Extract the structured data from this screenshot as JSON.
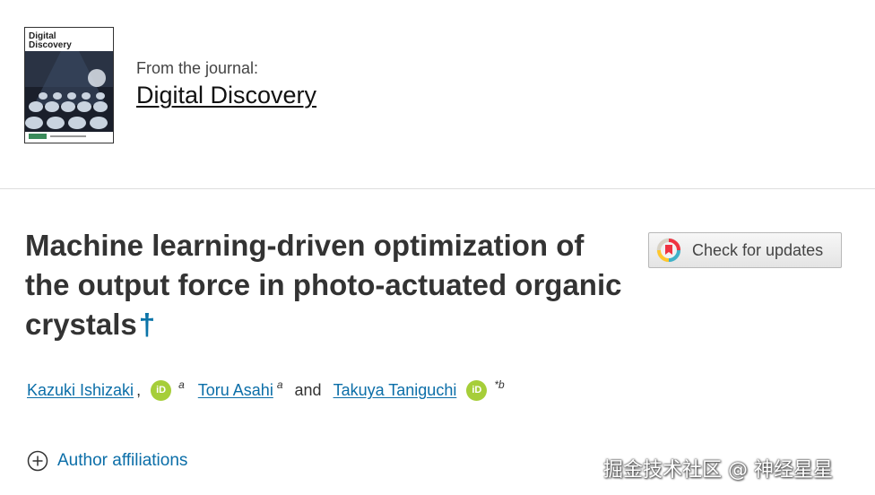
{
  "journal": {
    "cover_title": "Digital Discovery",
    "from_label": "From the journal:",
    "name": "Digital Discovery"
  },
  "article": {
    "title": "Machine learning-driven optimization of the output force in photo-actuated organic crystals",
    "dagger": "†"
  },
  "check_updates": {
    "label": "Check for updates"
  },
  "authors": [
    {
      "name": "Kazuki Ishizaki",
      "orcid": "iD",
      "affiliation": "a"
    },
    {
      "name": "Toru Asahi",
      "affiliation": "a"
    },
    {
      "name": "Takuya Taniguchi",
      "orcid": "iD",
      "affiliation": "*b"
    }
  ],
  "separators": {
    "comma": ",",
    "and": "and"
  },
  "affiliations_toggle": {
    "label": "Author affiliations"
  },
  "watermark": "掘金技术社区 @ 神经星星",
  "colors": {
    "link": "#0b6ea8",
    "orcid": "#a6ce39",
    "title": "#333333"
  }
}
